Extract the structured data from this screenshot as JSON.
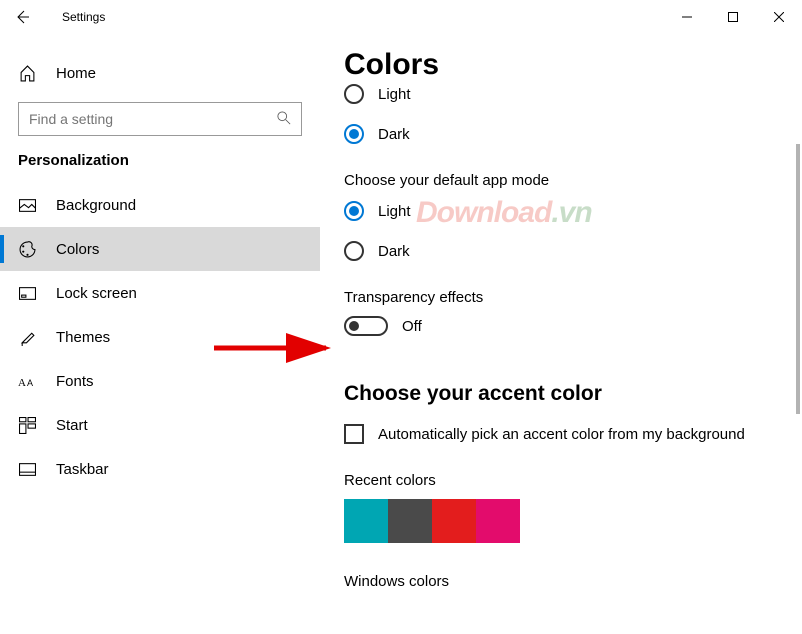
{
  "titlebar": {
    "title": "Settings"
  },
  "sidebar": {
    "home_label": "Home",
    "search_placeholder": "Find a setting",
    "category": "Personalization",
    "items": [
      {
        "label": "Background",
        "icon": "picture"
      },
      {
        "label": "Colors",
        "icon": "palette",
        "selected": true
      },
      {
        "label": "Lock screen",
        "icon": "lock-grid"
      },
      {
        "label": "Themes",
        "icon": "paintbrush"
      },
      {
        "label": "Fonts",
        "icon": "fonts"
      },
      {
        "label": "Start",
        "icon": "start-grid"
      },
      {
        "label": "Taskbar",
        "icon": "taskbar"
      }
    ]
  },
  "content": {
    "title": "Colors",
    "windows_mode": {
      "options": {
        "light": "Light",
        "dark": "Dark"
      },
      "selected": "dark"
    },
    "app_mode": {
      "label": "Choose your default app mode",
      "options": {
        "light": "Light",
        "dark": "Dark"
      },
      "selected": "light"
    },
    "transparency": {
      "label": "Transparency effects",
      "state_label": "Off",
      "enabled": false
    },
    "accent": {
      "heading": "Choose your accent color",
      "auto_pick_label": "Automatically pick an accent color from my background",
      "auto_pick_checked": false,
      "recent_label": "Recent colors",
      "recent_colors": [
        "#00a6b3",
        "#4a4a4a",
        "#e31d1d",
        "#e30c6c"
      ],
      "windows_colors_label": "Windows colors"
    }
  },
  "watermark": {
    "part1": "Download",
    "part2": ".vn"
  }
}
